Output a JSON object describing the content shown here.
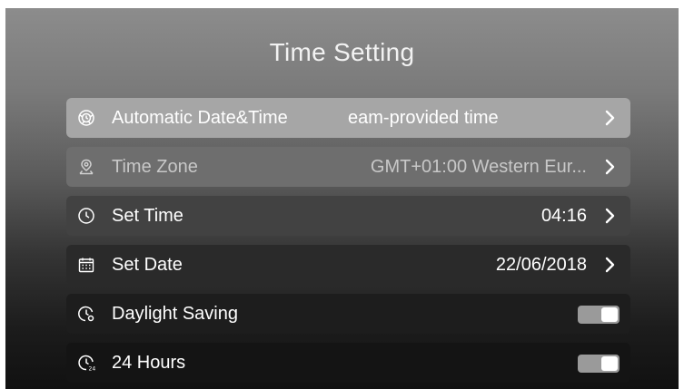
{
  "page": {
    "title": "Time Setting"
  },
  "rows": {
    "automatic": {
      "label": "Automatic Date&Time",
      "value": "eam-provided time",
      "icon": "globe-clock-icon"
    },
    "time_zone": {
      "label": "Time Zone",
      "value": "GMT+01:00 Western Eur...",
      "icon": "location-pin-icon"
    },
    "set_time": {
      "label": "Set Time",
      "value": "04:16",
      "icon": "clock-icon"
    },
    "set_date": {
      "label": "Set Date",
      "value": "22/06/2018",
      "icon": "calendar-icon"
    },
    "daylight_saving": {
      "label": "Daylight Saving",
      "enabled": true,
      "icon": "daylight-clock-icon"
    },
    "hours_24": {
      "label": "24 Hours",
      "enabled": true,
      "icon": "clock-24-icon"
    }
  },
  "colors": {
    "toggle_track": "#9a9a9a",
    "toggle_knob": "#ffffff",
    "text": "#ffffff",
    "disabled_text": "#c8c8c8"
  }
}
